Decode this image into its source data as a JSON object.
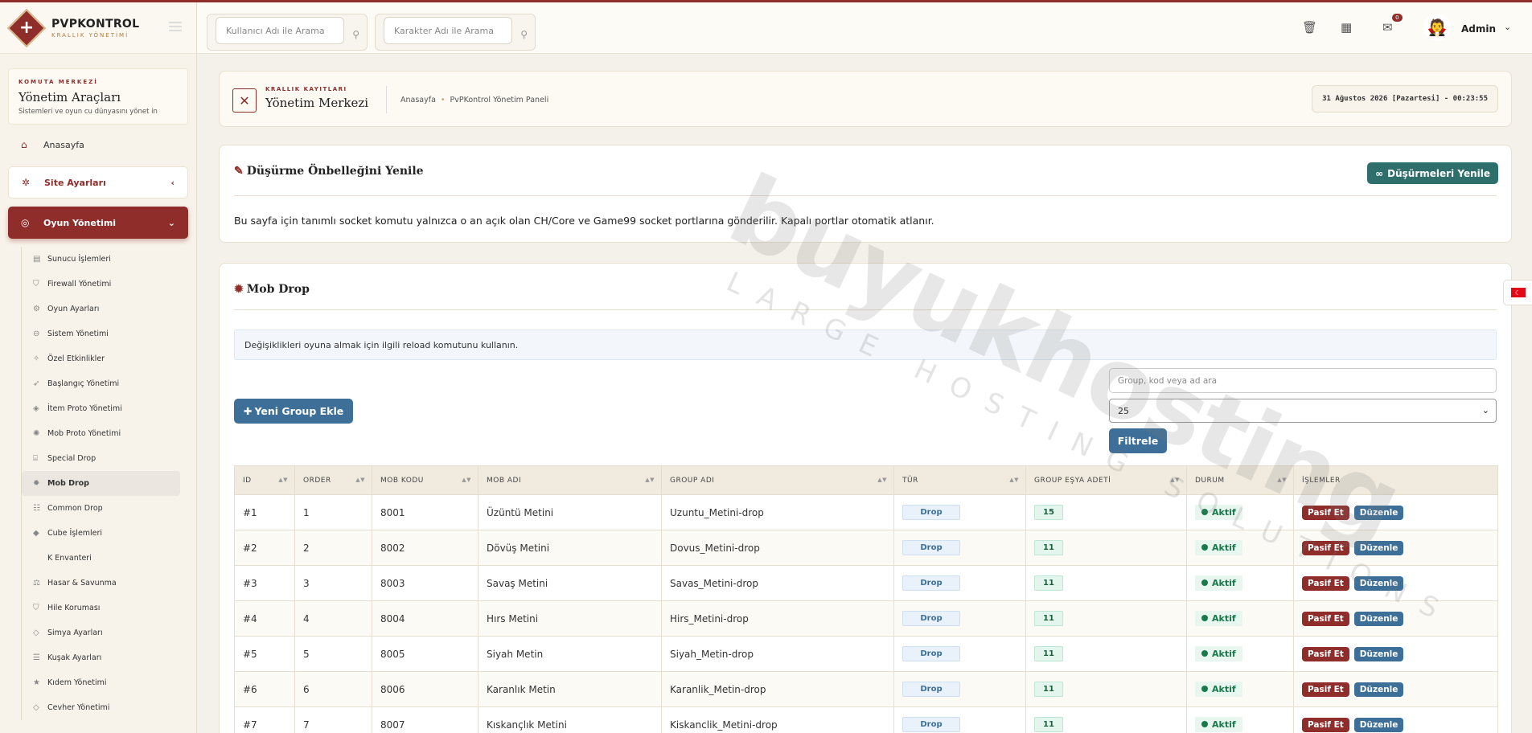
{
  "brand": {
    "name": "PVPKONTROL",
    "sub": "KRALLIK YÖNETİMİ"
  },
  "command": {
    "kicker": "KOMUTA MERKEZİ",
    "title": "Yönetim Araçları",
    "sub": "Sistemleri ve oyun cu dünyasını yönet in"
  },
  "nav": {
    "home": "Anasayfa",
    "site": "Site Ayarları",
    "game": "Oyun Yönetimi",
    "sub": [
      "Sunucu İşlemleri",
      "Firewall Yönetimi",
      "Oyun Ayarları",
      "Sistem Yönetimi",
      "Özel Etkinlikler",
      "Başlangıç Yönetimi",
      "İtem Proto Yönetimi",
      "Mob Proto Yönetimi",
      "Special Drop",
      "Mob Drop",
      "Common Drop",
      "Cube İşlemleri",
      "K Envanteri",
      "Hasar & Savunma",
      "Hile Koruması",
      "Simya Ayarları",
      "Kuşak Ayarları",
      "Kıdem Yönetimi",
      "Cevher Yönetimi"
    ]
  },
  "header": {
    "search_user": "Kullanıcı Adı ile Arama",
    "search_char": "Karakter Adı ile Arama",
    "mail_badge": "0",
    "admin": "Admin"
  },
  "crumb": {
    "kicker": "KRALLIK KAYITLARI",
    "title": "Yönetim Merkezi",
    "home": "Anasayfa",
    "page": "PvPKontrol Yönetim Paneli",
    "date": "31 Ağustos 2026 [Pazartesi] - 00:23:55"
  },
  "cache": {
    "title": "Düşürme Önbelleğini Yenile",
    "button": "Düşürmeleri Yenile",
    "desc": "Bu sayfa için tanımlı socket komutu yalnızca o an açık olan CH/Core ve Game99 socket portlarına gönderilir. Kapalı portlar otomatik atlanır."
  },
  "mob": {
    "title": "Mob Drop",
    "info": "Değişiklikleri oyuna almak için ilgili reload komutunu kullanın.",
    "new_button": "Yeni Group Ekle",
    "search_placeholder": "Group, kod veya ad ara",
    "per_page": "25",
    "filter_button": "Filtrele",
    "columns": [
      "ID",
      "ORDER",
      "MOB KODU",
      "MOB ADI",
      "GROUP ADI",
      "TÜR",
      "GROUP EŞYA ADETİ",
      "DURUM",
      "İŞLEMLER"
    ],
    "rows": [
      {
        "id": "#1",
        "order": "1",
        "code": "8001",
        "name": "Üzüntü Metini",
        "group": "Uzuntu_Metini-drop",
        "type": "Drop",
        "count": "15",
        "status": "Aktif"
      },
      {
        "id": "#2",
        "order": "2",
        "code": "8002",
        "name": "Dövüş Metini",
        "group": "Dovus_Metini-drop",
        "type": "Drop",
        "count": "11",
        "status": "Aktif"
      },
      {
        "id": "#3",
        "order": "3",
        "code": "8003",
        "name": "Savaş Metini",
        "group": "Savas_Metini-drop",
        "type": "Drop",
        "count": "11",
        "status": "Aktif"
      },
      {
        "id": "#4",
        "order": "4",
        "code": "8004",
        "name": "Hırs Metini",
        "group": "Hirs_Metini-drop",
        "type": "Drop",
        "count": "11",
        "status": "Aktif"
      },
      {
        "id": "#5",
        "order": "5",
        "code": "8005",
        "name": "Siyah Metin",
        "group": "Siyah_Metin-drop",
        "type": "Drop",
        "count": "11",
        "status": "Aktif"
      },
      {
        "id": "#6",
        "order": "6",
        "code": "8006",
        "name": "Karanlık Metin",
        "group": "Karanlik_Metin-drop",
        "type": "Drop",
        "count": "11",
        "status": "Aktif"
      },
      {
        "id": "#7",
        "order": "7",
        "code": "8007",
        "name": "Kıskançlık Metini",
        "group": "Kiskanclik_Metini-drop",
        "type": "Drop",
        "count": "11",
        "status": "Aktif"
      }
    ],
    "btn_pasif": "Pasif Et",
    "btn_edit": "Düzenle"
  },
  "watermark": {
    "main": "buyukhosting",
    "sub": "LARGE HOSTING SOLUTIONS"
  },
  "colors": {
    "accent": "#8e2d2a",
    "teal": "#2f6f6b",
    "blue": "#3d6f98"
  }
}
